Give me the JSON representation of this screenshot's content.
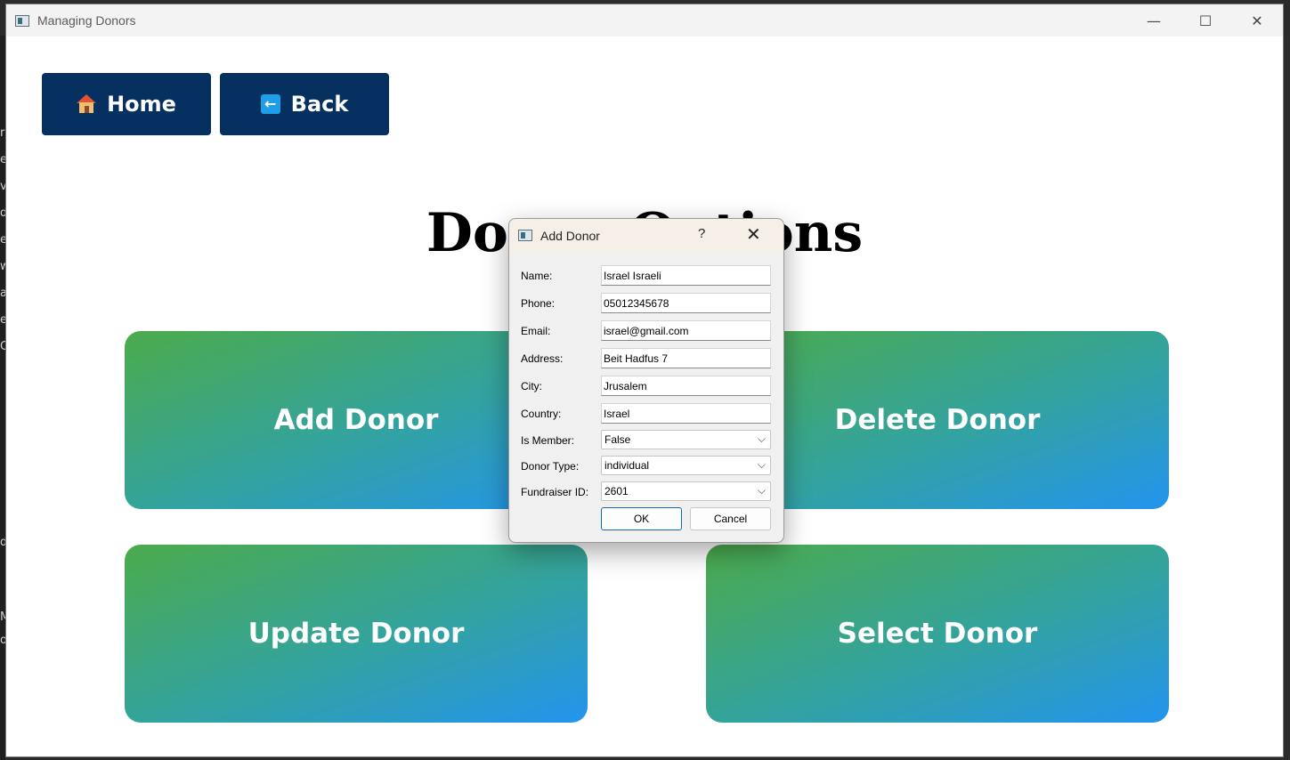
{
  "window": {
    "title": "Managing Donors",
    "controls": {
      "minimize": "—",
      "maximize": "☐",
      "close": "✕"
    }
  },
  "nav": {
    "home_label": "Home",
    "back_label": "Back"
  },
  "page": {
    "title": "Donor Options"
  },
  "tiles": {
    "add": "Add Donor",
    "delete": "Delete Donor",
    "update": "Update Donor",
    "select": "Select Donor"
  },
  "dialog": {
    "title": "Add Donor",
    "help": "?",
    "close": "✕",
    "fields": {
      "name": {
        "label": "Name:",
        "value": "Israel Israeli"
      },
      "phone": {
        "label": "Phone:",
        "value": "05012345678"
      },
      "email": {
        "label": "Email:",
        "value": "israel@gmail.com"
      },
      "address": {
        "label": "Address:",
        "value": "Beit Hadfus 7"
      },
      "city": {
        "label": "City:",
        "value": "Jrusalem"
      },
      "country": {
        "label": "Country:",
        "value": "Israel"
      },
      "is_member": {
        "label": "Is Member:",
        "value": "False"
      },
      "donor_type": {
        "label": "Donor Type:",
        "value": "individual"
      },
      "fundraiser_id": {
        "label": "Fundraiser ID:",
        "value": "2601"
      }
    },
    "ok_label": "OK",
    "cancel_label": "Cancel"
  },
  "background_edge_glyphs": [
    "r",
    "e",
    "v",
    "d",
    "e",
    "w",
    "a",
    "e",
    "C",
    "d",
    "M",
    "o"
  ],
  "colors": {
    "nav_button": "#06305f",
    "tile_gradient_start": "#4cab4c",
    "tile_gradient_end": "#2394ee",
    "primary_button_border": "#0f6cbd"
  }
}
